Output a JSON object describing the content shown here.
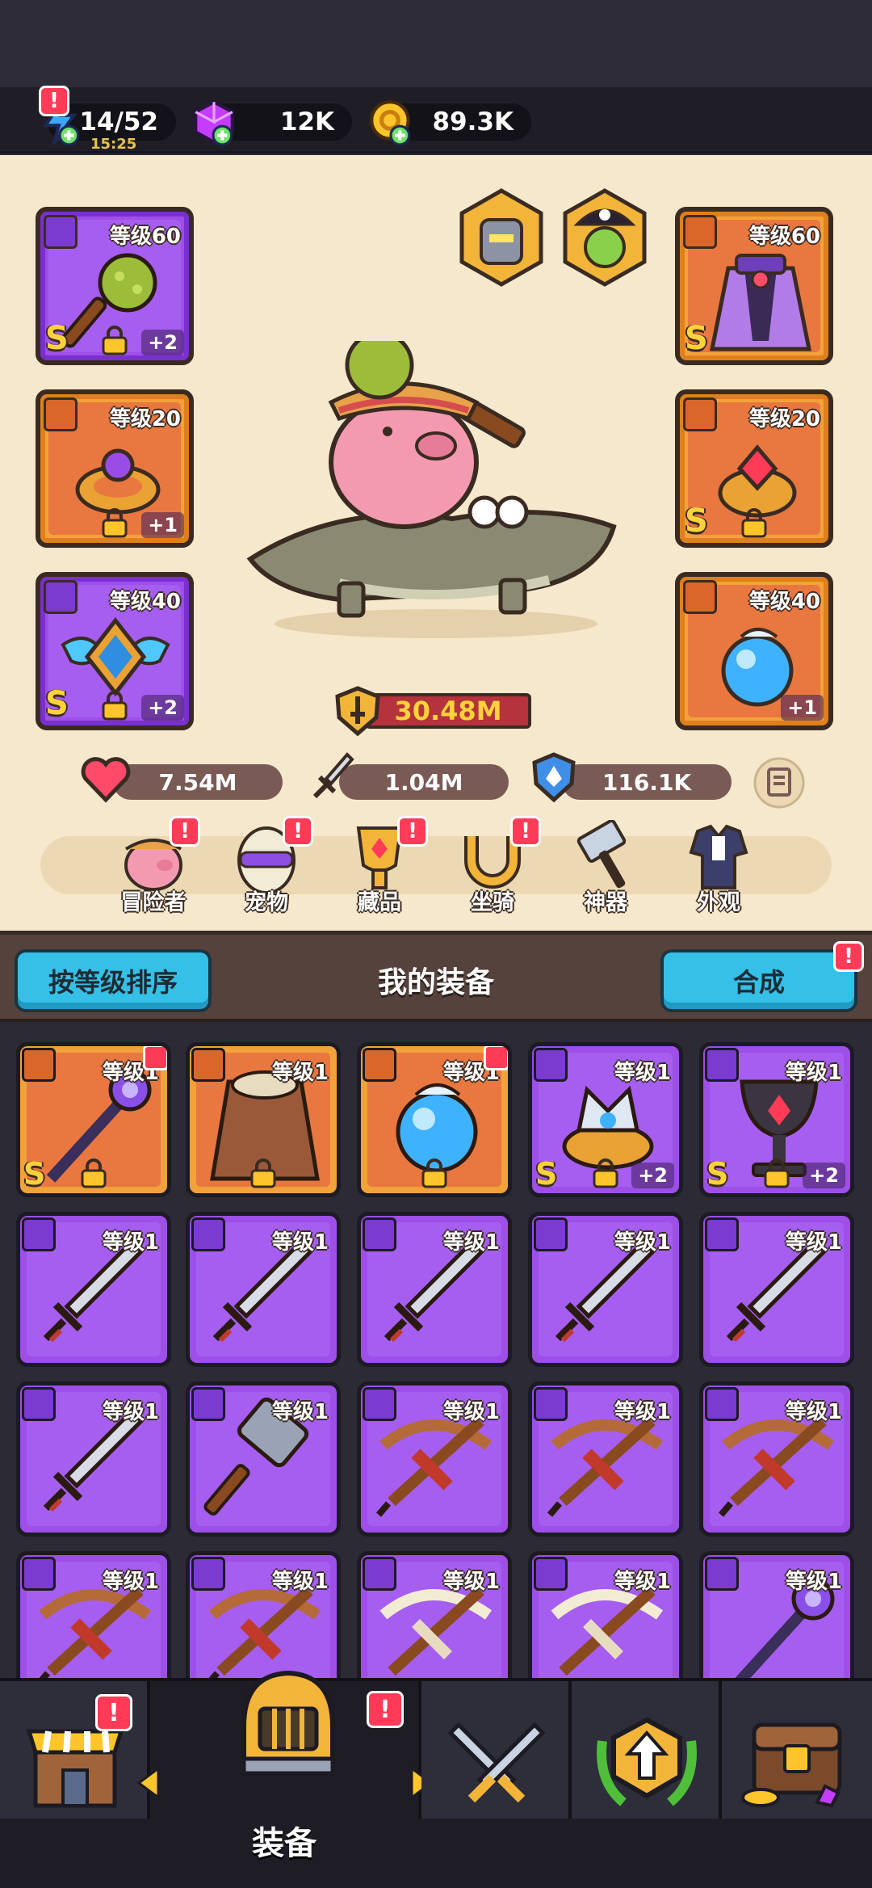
{
  "resources": {
    "energy": {
      "value": "14/52",
      "timer": "15:25",
      "icon": "lightning-icon"
    },
    "gems": {
      "value": "12K",
      "icon": "gem-icon"
    },
    "coins": {
      "value": "89.3K",
      "icon": "coin-icon"
    }
  },
  "equipped": {
    "weapon": {
      "level": "等级60",
      "rank": "S",
      "plus": "+2"
    },
    "armor": {
      "level": "等级60",
      "rank": "S"
    },
    "ring_left": {
      "level": "等级20",
      "plus": "+1"
    },
    "ring_right": {
      "level": "等级20",
      "rank": "S"
    },
    "necklace_left": {
      "level": "等级40",
      "rank": "S",
      "plus": "+2"
    },
    "necklace_right": {
      "level": "等级40",
      "plus": "+1"
    }
  },
  "power": "30.48M",
  "stats": {
    "hp": "7.54M",
    "attack": "1.04M",
    "defense": "116.1K"
  },
  "tabs": [
    {
      "label": "冒险者",
      "icon": "pig-adventurer-icon"
    },
    {
      "label": "宠物",
      "icon": "egg-pet-icon"
    },
    {
      "label": "藏品",
      "icon": "trophy-collection-icon"
    },
    {
      "label": "坐骑",
      "icon": "horseshoe-mount-icon"
    },
    {
      "label": "神器",
      "icon": "hammer-artifact-icon"
    },
    {
      "label": "外观",
      "icon": "outfit-icon"
    }
  ],
  "bag": {
    "sort_label": "按等级排序",
    "title": "我的装备",
    "merge_label": "合成"
  },
  "items": [
    {
      "level": "等级1",
      "color": "orange",
      "rank": "S",
      "lock": true,
      "gem": true,
      "icon": "staff-icon"
    },
    {
      "level": "等级1",
      "color": "orange",
      "lock": true,
      "icon": "fur-armor-icon"
    },
    {
      "level": "等级1",
      "color": "orange",
      "lock": true,
      "gem": true,
      "icon": "blue-orb-icon"
    },
    {
      "level": "等级1",
      "color": "purple",
      "rank": "S",
      "lock": true,
      "plus": "+2",
      "icon": "crown-ring-icon"
    },
    {
      "level": "等级1",
      "color": "purple",
      "rank": "S",
      "lock": true,
      "plus": "+2",
      "icon": "goblet-icon"
    },
    {
      "level": "等级1",
      "color": "purple",
      "icon": "sword-icon"
    },
    {
      "level": "等级1",
      "color": "purple",
      "icon": "sword-icon"
    },
    {
      "level": "等级1",
      "color": "purple",
      "icon": "sword-icon"
    },
    {
      "level": "等级1",
      "color": "purple",
      "icon": "sword-icon"
    },
    {
      "level": "等级1",
      "color": "purple",
      "icon": "sword-icon"
    },
    {
      "level": "等级1",
      "color": "purple",
      "icon": "sword-icon"
    },
    {
      "level": "等级1",
      "color": "purple",
      "icon": "hammer-icon"
    },
    {
      "level": "等级1",
      "color": "purple",
      "icon": "crossbow-icon"
    },
    {
      "level": "等级1",
      "color": "purple",
      "icon": "crossbow-icon"
    },
    {
      "level": "等级1",
      "color": "purple",
      "icon": "crossbow-icon"
    },
    {
      "level": "等级1",
      "color": "purple",
      "icon": "crossbow-icon"
    },
    {
      "level": "等级1",
      "color": "purple",
      "icon": "crossbow-icon"
    },
    {
      "level": "等级1",
      "color": "purple",
      "icon": "bone-crossbow-icon"
    },
    {
      "level": "等级1",
      "color": "purple",
      "icon": "bone-crossbow-icon"
    },
    {
      "level": "等级1",
      "color": "purple",
      "icon": "staff-icon"
    }
  ],
  "bottom_nav": {
    "active_label": "装备"
  }
}
